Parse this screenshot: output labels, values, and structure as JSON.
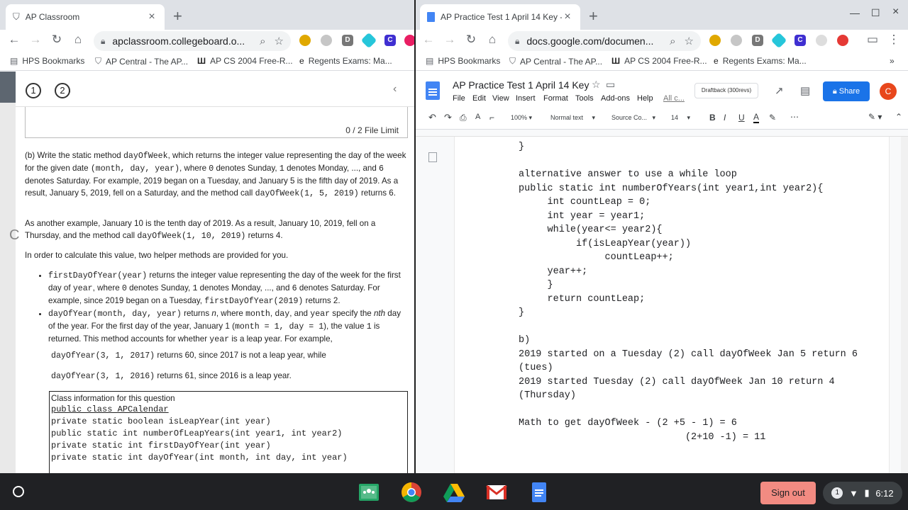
{
  "left_window": {
    "tab_title": "AP Classroom",
    "url": "apclassroom.collegeboard.o...",
    "bookmarks": [
      "HPS Bookmarks",
      "AP Central - The AP...",
      "AP CS 2004 Free-R...",
      "Regents Exams: Ma..."
    ],
    "steps": [
      "1",
      "2"
    ],
    "file_limit": "0 / 2 File Limit",
    "question_b": {
      "p1_pre": "(b) Write the static method ",
      "p1_method": "dayOfWeek",
      "p1_a": ", which returns the integer value representing the day of the week for the given date ",
      "p1_args": "(month, day, year)",
      "p1_b": ", where ",
      "zero": "0",
      "p1_c": " denotes Sunday, ",
      "one": "1",
      "p1_d": " denotes Monday, ..., and ",
      "six": "6",
      "p1_e": " denotes Saturday. For example, 2019 began on a Tuesday, and January 5 is the fifth day of 2019. As a result, January 5, 2019, fell on a Saturday, and the method call ",
      "p1_call": "dayOfWeek(1, 5, 2019)",
      "p1_f": " returns ",
      "p1_g": ".",
      "p2_a": "As another example, January 10 is the tenth day of 2019. As a result, January 10, 2019, fell on a Thursday, and the method call ",
      "p2_call": "dayOfWeek(1, 10, 2019)",
      "p2_b": " returns 4.",
      "p3": "In order to calculate this value, two helper methods are provided for you.",
      "li1_call": "firstDayOfYear(year)",
      "li1_a": " returns the integer value representing the day of the week for the first day of ",
      "li1_year": "year",
      "li1_b": ", where ",
      "li1_c": " denotes Sunday, ",
      "li1_d": " denotes Monday, ..., and ",
      "li1_e": " denotes Saturday. For example, since 2019 began on a Tuesday, ",
      "li1_call2": "firstDayOfYear(2019)",
      "li1_f": " returns 2.",
      "li2_call": "dayOfYear(month, day, year)",
      "li2_a": " returns ",
      "li2_n": "n",
      "li2_b": ", where ",
      "li2_month": "month",
      "li2_comma1": ", ",
      "li2_day": "day",
      "li2_and": ", and ",
      "li2_year": "year",
      "li2_c": " specify the ",
      "li2_nth": "nth",
      "li2_d": " day of the year. For the first day of the year, January 1 (",
      "li2_cond": "month = 1, day = 1",
      "li2_e": "), the value ",
      "li2_one": "1",
      "li2_f": " is returned. This method accounts for whether ",
      "li2_year2": "year",
      "li2_g": " is a leap year. For example,",
      "ex1_call": "dayOfYear(3, 1, 2017)",
      "ex1_text": " returns 60, since 2017 is not a leap year, while",
      "ex2_call": "dayOfYear(3, 1, 2016)",
      "ex2_text": " returns 61, since 2016 is a leap year."
    },
    "class_box": {
      "title": "Class information for this question",
      "lines": [
        "public class APCalendar",
        "private static boolean isLeapYear(int year)",
        "public static int numberOfLeapYears(int year1, int year2)",
        "private static int firstDayOfYear(int year)",
        "private static int dayOfYear(int month, int day, int year)"
      ]
    }
  },
  "right_window": {
    "tab_title": "AP Practice Test 1 April 14 Key -",
    "url": "docs.google.com/documen...",
    "bookmarks": [
      "HPS Bookmarks",
      "AP Central - The AP...",
      "AP CS 2004 Free-R...",
      "Regents Exams: Ma..."
    ],
    "doc_title": "AP Practice Test 1 April 14 Key",
    "menu": [
      "File",
      "Edit",
      "View",
      "Insert",
      "Format",
      "Tools",
      "Add-ons",
      "Help",
      "All c..."
    ],
    "draftback": "Draftback (300revs)",
    "share": "Share",
    "avatar": "C",
    "format_bar": {
      "zoom": "100%",
      "style": "Normal text",
      "font": "Source Co...",
      "size": "14"
    },
    "code_text": "}\n\nalternative answer to use a while loop\npublic static int numberOfYears(int year1,int year2){\n     int countLeap = 0;\n     int year = year1;\n     while(year<= year2){\n          if(isLeapYear(year))\n               countLeap++;\n     year++;\n     }\n     return countLeap;\n}\n\nb)\n2019 started on a Tuesday (2) call dayOfWeek Jan 5 return 6\n(tues)\n2019 started Tuesday (2) call dayOfWeek Jan 10 return 4\n(Thursday)\n\nMath to get dayOfWeek - (2 +5 - 1) = 6\n                             (2+10 -1) = 11"
  },
  "shelf": {
    "sign_out": "Sign out",
    "notification_count": "1",
    "time": "6:12"
  },
  "colors": {
    "chrome_tabstrip": "#dee1e6",
    "share_blue": "#1a73e8",
    "sign_out_bg": "#f28b82",
    "shelf_bg": "#202124"
  }
}
